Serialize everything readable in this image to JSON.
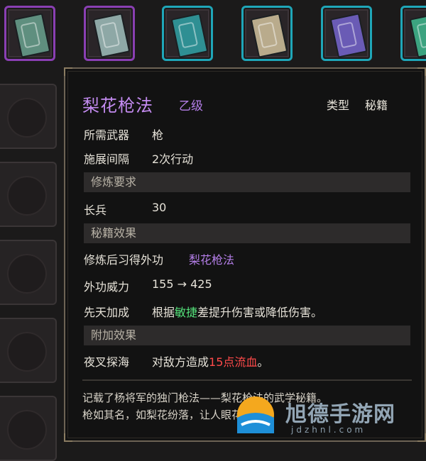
{
  "top_slots": [
    {
      "color": "#8a3fb3",
      "book": "#5f8f7f"
    },
    {
      "color": "#8a3fb3",
      "book": "#8ea8a6"
    },
    {
      "color": "#1fa6b8",
      "book": "#2f8f93"
    },
    {
      "color": "#1fa6b8",
      "book": "#b9ab8c"
    },
    {
      "color": "#1fa6b8",
      "book": "#6a5bb5"
    },
    {
      "color": "#1fa6b8",
      "book": "#3ca380"
    }
  ],
  "skill": {
    "name": "梨花枪法",
    "grade": "乙级",
    "type_label": "类型",
    "type_value": "秘籍"
  },
  "stats": {
    "weapon_label": "所需武器",
    "weapon_value": "枪",
    "interval_label": "施展间隔",
    "interval_value": "2次行动"
  },
  "requirements": {
    "header": "修炼要求",
    "label": "长兵",
    "value": "30"
  },
  "effects": {
    "header": "秘籍效果",
    "learn_label": "修炼后习得外功",
    "learn_value": "梨花枪法",
    "power_label": "外功威力",
    "power_value": "155 → 425",
    "bonus_label": "先天加成",
    "bonus_pre": "根据",
    "bonus_attr": "敏捷",
    "bonus_post": "差提升伤害或降低伤害。"
  },
  "extra": {
    "header": "附加效果",
    "label": "夜叉探海",
    "pre": "对敌方造成",
    "highlight": "15点流血",
    "post": "。"
  },
  "description": {
    "line1": "记载了杨将军的独门枪法——梨花枪法的武学秘籍。",
    "line2": "枪如其名，如梨花纷落，让人眼花缭乱。"
  },
  "watermark": {
    "text": "旭德手游网",
    "url": "jdzhnl.com"
  }
}
